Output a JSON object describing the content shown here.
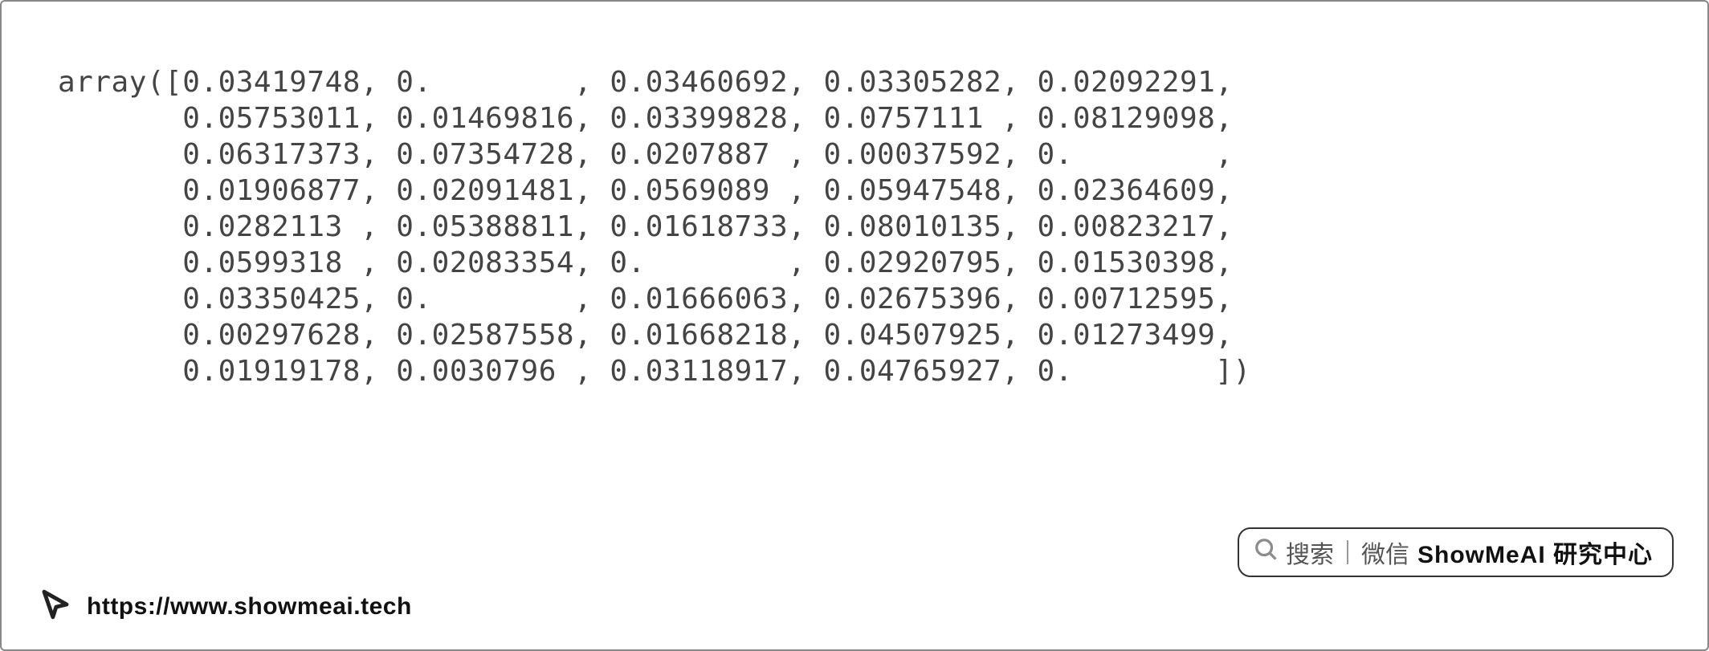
{
  "output": {
    "prefix": "array([",
    "values": [
      "0.03419748",
      "0.        ",
      "0.03460692",
      "0.03305282",
      "0.02092291",
      "0.05753011",
      "0.01469816",
      "0.03399828",
      "0.0757111 ",
      "0.08129098",
      "0.06317373",
      "0.07354728",
      "0.0207887 ",
      "0.00037592",
      "0.        ",
      "0.01906877",
      "0.02091481",
      "0.0569089 ",
      "0.05947548",
      "0.02364609",
      "0.0282113 ",
      "0.05388811",
      "0.01618733",
      "0.08010135",
      "0.00823217",
      "0.0599318 ",
      "0.02083354",
      "0.        ",
      "0.02920795",
      "0.01530398",
      "0.03350425",
      "0.        ",
      "0.01666063",
      "0.02675396",
      "0.00712595",
      "0.00297628",
      "0.02587558",
      "0.01668218",
      "0.04507925",
      "0.01273499",
      "0.01919178",
      "0.0030796 ",
      "0.03118917",
      "0.04765927",
      "0.        "
    ],
    "suffix": "])",
    "columns_per_row": 5,
    "indent": "       "
  },
  "search": {
    "label_search": "搜索",
    "label_wechat": "微信",
    "brand": "ShowMeAI 研究中心"
  },
  "footer": {
    "url": "https://www.showmeai.tech"
  }
}
